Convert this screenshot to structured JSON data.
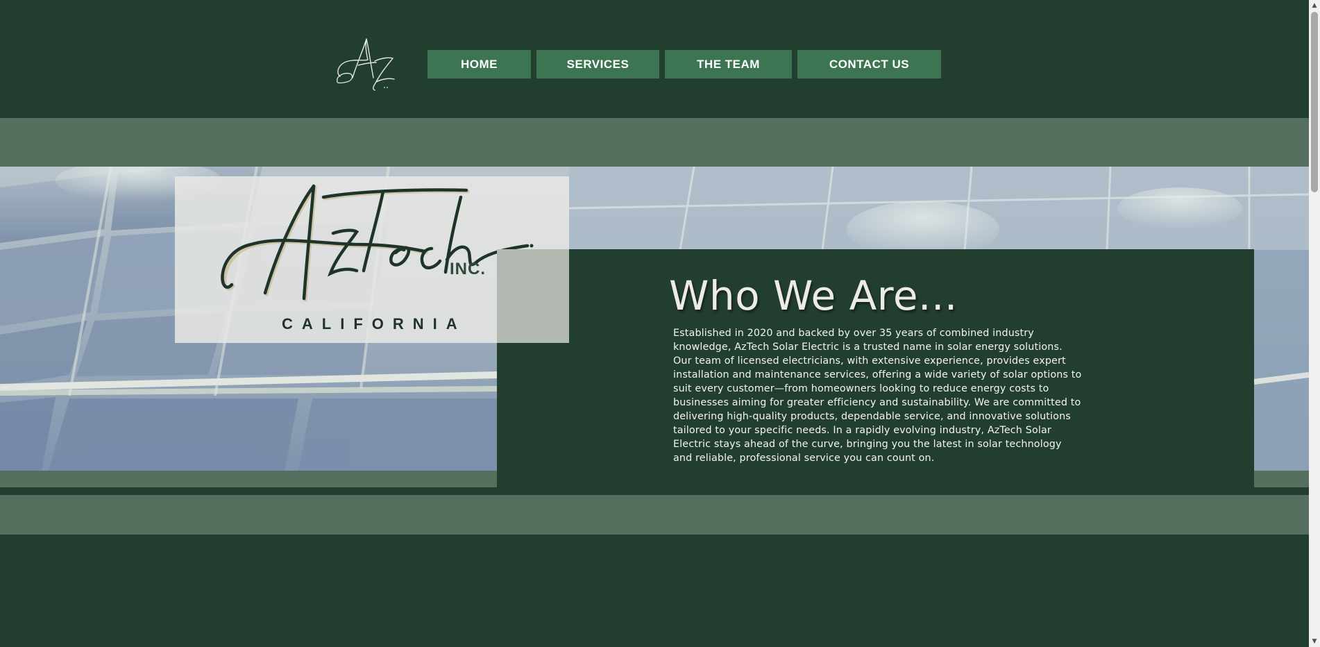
{
  "header": {
    "logo_alt": "AzTech monogram logo",
    "nav": [
      {
        "label": "HOME"
      },
      {
        "label": "SERVICES"
      },
      {
        "label": "THE TEAM"
      },
      {
        "label": "CONTACT US"
      }
    ]
  },
  "hero": {
    "logo_wordmark": "AzTech",
    "logo_suffix": "INC.",
    "logo_region": "CALIFORNIA",
    "image_subject": "solar panels"
  },
  "about": {
    "title": "Who We Are...",
    "body": "Established in 2020 and backed by over 35 years of combined industry knowledge, AzTech Solar Electric is a trusted name in solar energy solutions. Our team of licensed electricians, with extensive experience, provides expert installation and maintenance services, offering a wide variety of solar options to suit every customer—from homeowners looking to reduce energy costs to businesses aiming for greater efficiency and sustainability. We are committed to delivering high-quality products, dependable service, and innovative solutions tailored to your specific needs. In a rapidly evolving industry, AzTech Solar Electric stays ahead of the curve, bringing you the latest in solar technology and reliable, professional service you can count on."
  },
  "colors": {
    "background": "#223e2e",
    "nav_button": "#3d7553",
    "band": "#566e5e",
    "title_text": "#ecebe4"
  },
  "icons": {
    "scroll_up": "triangle-up-icon",
    "scroll_down": "triangle-down-icon"
  }
}
